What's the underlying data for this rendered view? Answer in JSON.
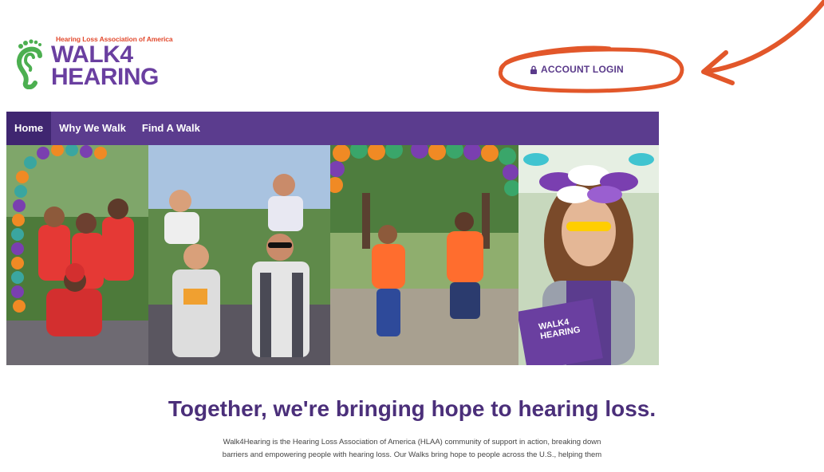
{
  "logo": {
    "org": "Hearing Loss Association of America",
    "line1": "WALK4",
    "line2": "HEARING"
  },
  "header": {
    "login_label": "ACCOUNT LOGIN",
    "login_icon": "lock-icon"
  },
  "nav": {
    "items": [
      {
        "label": "Home",
        "active": true
      },
      {
        "label": "Why We Walk",
        "active": false
      },
      {
        "label": "Find A Walk",
        "active": false
      }
    ]
  },
  "banner": {
    "sign_line1": "WALK4",
    "sign_line2": "HEARING"
  },
  "main": {
    "headline": "Together, we're bringing hope to hearing loss.",
    "paragraph_line1": "Walk4Hearing is the Hearing Loss Association of America (HLAA) community of support in action, breaking down",
    "paragraph_line2": "barriers and empowering people with hearing loss. Our Walks bring hope to people across the U.S., helping them"
  },
  "colors": {
    "brand_purple": "#5b3c8e",
    "nav_active": "#3f2670",
    "annotation_orange": "#e2572a",
    "headline": "#4b2f7a"
  }
}
